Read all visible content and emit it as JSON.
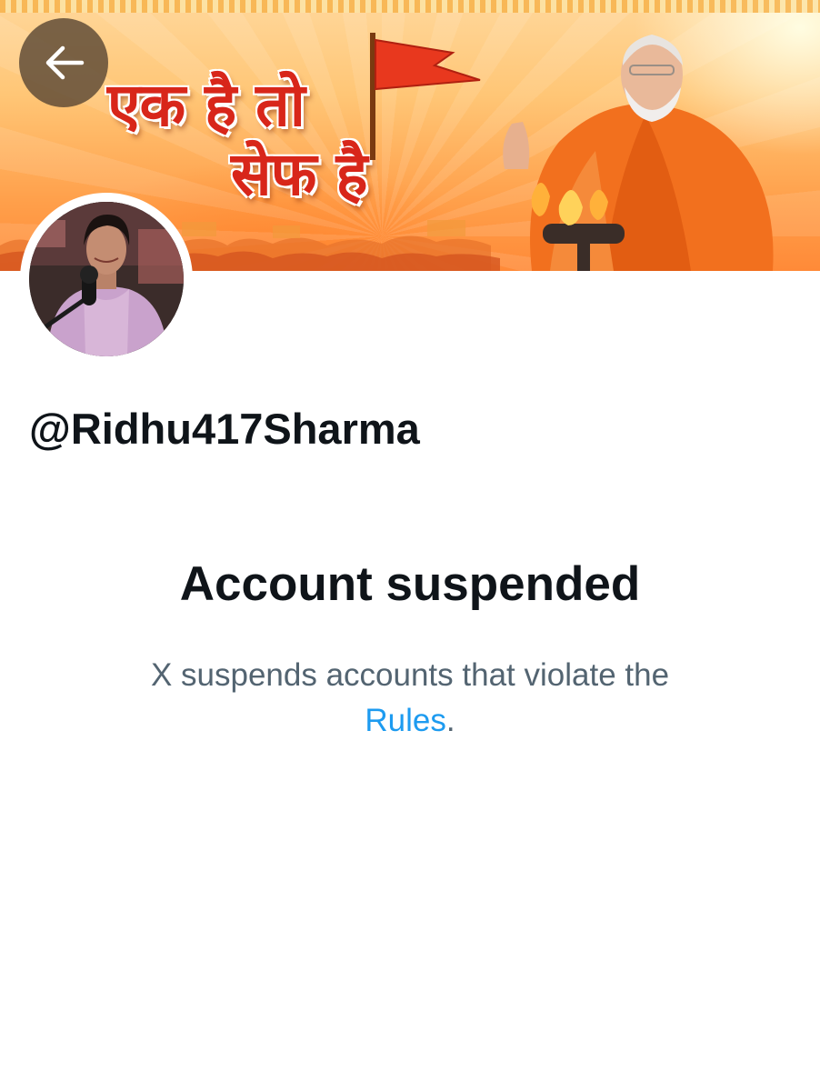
{
  "banner": {
    "slogan_line1": "एक है तो",
    "slogan_line2": "सेफ है"
  },
  "profile": {
    "handle": "@Ridhu417Sharma"
  },
  "suspension": {
    "title": "Account suspended",
    "description": "X suspends accounts that violate the",
    "rules_link": "Rules",
    "trailing": "."
  },
  "colors": {
    "text_primary": "#0f1419",
    "text_secondary": "#536471",
    "link": "#1d9bf0",
    "back_button_bg": "#5c4834"
  },
  "icons": {
    "back": "arrow-left-icon"
  }
}
